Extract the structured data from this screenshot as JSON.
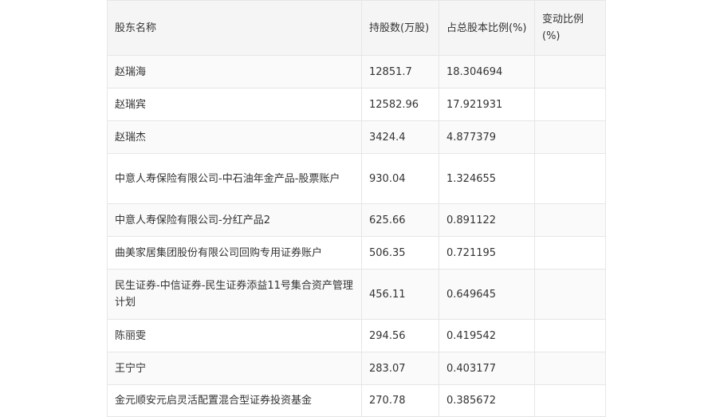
{
  "table": {
    "headers": {
      "name": "股东名称",
      "shares": "持股数(万股)",
      "ratio": "占总股本比例(%)",
      "change": "变动比例(%)"
    },
    "rows": [
      {
        "name": "赵瑞海",
        "shares": "12851.7",
        "ratio": "18.304694",
        "change": ""
      },
      {
        "name": "赵瑞宾",
        "shares": "12582.96",
        "ratio": "17.921931",
        "change": ""
      },
      {
        "name": "赵瑞杰",
        "shares": "3424.4",
        "ratio": "4.877379",
        "change": ""
      },
      {
        "name": "中意人寿保险有限公司-中石油年金产品-股票账户",
        "shares": "930.04",
        "ratio": "1.324655",
        "change": ""
      },
      {
        "name": "中意人寿保险有限公司-分红产品2",
        "shares": "625.66",
        "ratio": "0.891122",
        "change": ""
      },
      {
        "name": "曲美家居集团股份有限公司回购专用证券账户",
        "shares": "506.35",
        "ratio": "0.721195",
        "change": ""
      },
      {
        "name": "民生证券-中信证券-民生证券添益11号集合资产管理计划",
        "shares": "456.11",
        "ratio": "0.649645",
        "change": ""
      },
      {
        "name": "陈丽雯",
        "shares": "294.56",
        "ratio": "0.419542",
        "change": ""
      },
      {
        "name": "王宁宁",
        "shares": "283.07",
        "ratio": "0.403177",
        "change": ""
      },
      {
        "name": "金元顺安元启灵活配置混合型证券投资基金",
        "shares": "270.78",
        "ratio": "0.385672",
        "change": ""
      }
    ]
  }
}
